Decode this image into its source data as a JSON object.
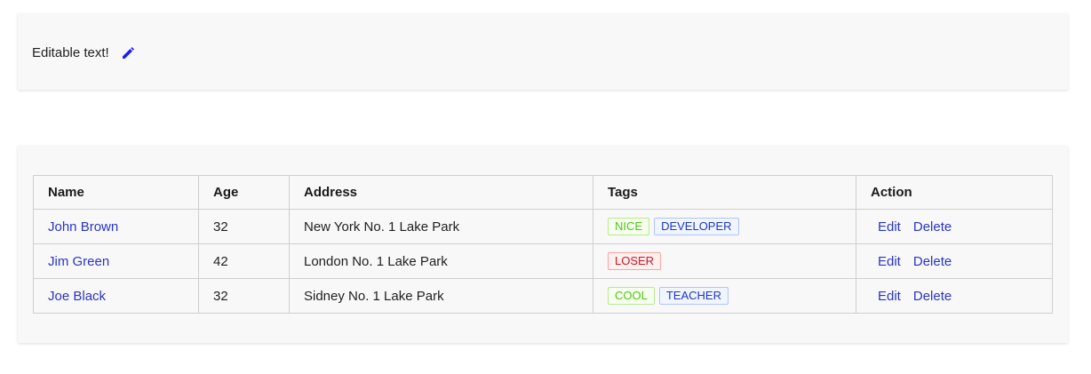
{
  "editable": {
    "text": "Editable text!",
    "icon": "pencil-icon",
    "icon_color": "#1a1aff"
  },
  "table": {
    "columns": [
      "Name",
      "Age",
      "Address",
      "Tags",
      "Action"
    ],
    "rows": [
      {
        "name": "John Brown",
        "age": "32",
        "address": "New York No. 1 Lake Park",
        "tags": [
          {
            "label": "NICE",
            "color": "green"
          },
          {
            "label": "DEVELOPER",
            "color": "blue"
          }
        ],
        "actions": [
          "Edit",
          "Delete"
        ]
      },
      {
        "name": "Jim Green",
        "age": "42",
        "address": "London No. 1 Lake Park",
        "tags": [
          {
            "label": "LOSER",
            "color": "red"
          }
        ],
        "actions": [
          "Edit",
          "Delete"
        ]
      },
      {
        "name": "Joe Black",
        "age": "32",
        "address": "Sidney No. 1 Lake Park",
        "tags": [
          {
            "label": "COOL",
            "color": "green"
          },
          {
            "label": "TEACHER",
            "color": "blue"
          }
        ],
        "actions": [
          "Edit",
          "Delete"
        ]
      }
    ]
  },
  "colors": {
    "link": "#2a35c4",
    "card_background": "#f8f8f8",
    "tag_green": "#52c41a",
    "tag_blue": "#1d39c4",
    "tag_red": "#cf1322"
  }
}
